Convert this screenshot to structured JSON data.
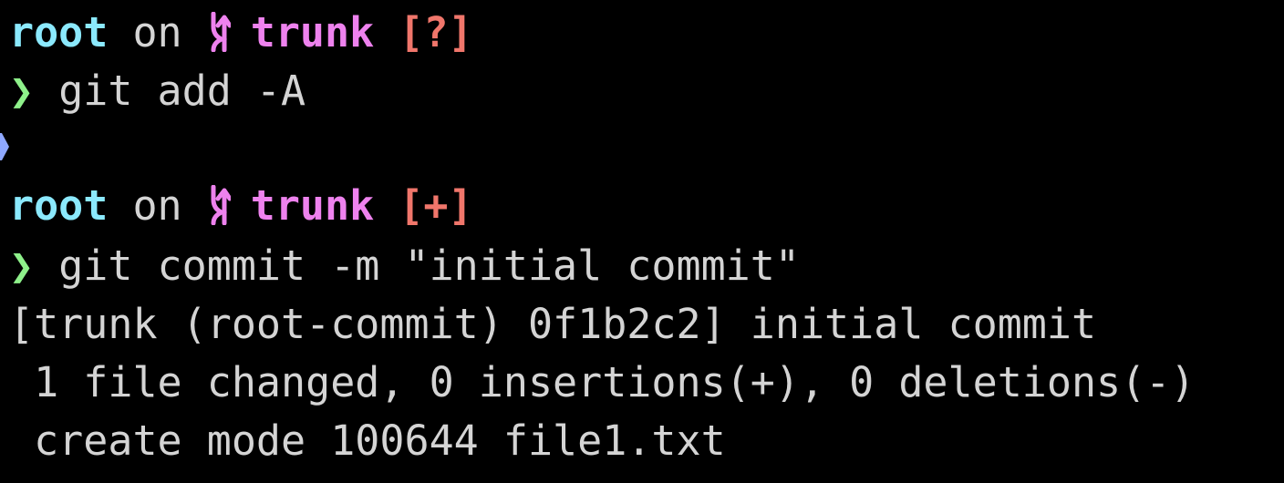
{
  "terminal": {
    "colors": {
      "background": "#000000",
      "user": "#8be9fd",
      "branch": "#ee82ee",
      "status": "#f0766b",
      "prompt": "#8ef08a",
      "text": "#d4d4d4",
      "marker": "#8fa8ff"
    },
    "prompt1": {
      "user": "root",
      "on": "on",
      "branch_icon": "git-branch-icon",
      "branch": "trunk",
      "status": "[?]",
      "symbol": "❯",
      "command": "git add -A"
    },
    "prompt2": {
      "user": "root",
      "on": "on",
      "branch_icon": "git-branch-icon",
      "branch": "trunk",
      "status": "[+]",
      "symbol": "❯",
      "command": "git commit -m \"initial commit\""
    },
    "output": [
      "[trunk (root-commit) 0f1b2c2] initial commit",
      " 1 file changed, 0 insertions(+), 0 deletions(-)",
      " create mode 100644 file1.txt"
    ]
  }
}
